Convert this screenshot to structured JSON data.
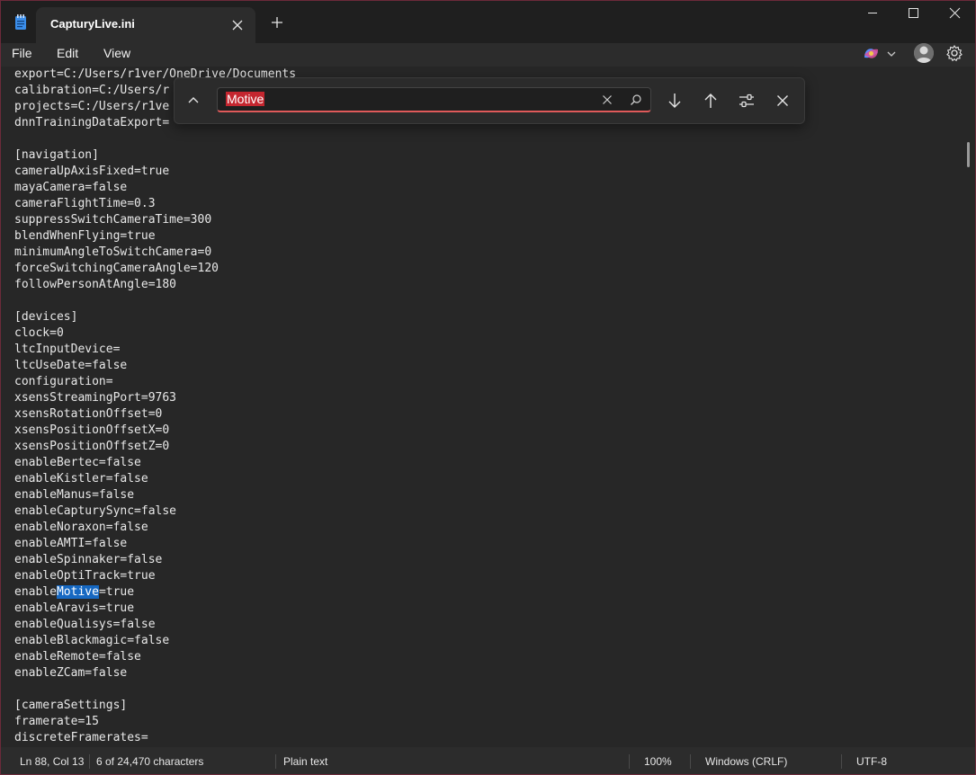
{
  "window": {
    "tab_title": "CapturyLive.ini"
  },
  "menu": {
    "file": "File",
    "edit": "Edit",
    "view": "View"
  },
  "find": {
    "query": "Motive"
  },
  "editor": {
    "lines": [
      "export=C:/Users/r1ver/OneDrive/Documents",
      "calibration=C:/Users/r",
      "projects=C:/Users/r1ve",
      "dnnTrainingDataExport=",
      "",
      "[navigation]",
      "cameraUpAxisFixed=true",
      "mayaCamera=false",
      "cameraFlightTime=0.3",
      "suppressSwitchCameraTime=300",
      "blendWhenFlying=true",
      "minimumAngleToSwitchCamera=0",
      "forceSwitchingCameraAngle=120",
      "followPersonAtAngle=180",
      "",
      "[devices]",
      "clock=0",
      "ltcInputDevice=",
      "ltcUseDate=false",
      "configuration=",
      "xsensStreamingPort=9763",
      "xsensRotationOffset=0",
      "xsensPositionOffsetX=0",
      "xsensPositionOffsetZ=0",
      "enableBertec=false",
      "enableKistler=false",
      "enableManus=false",
      "enableCapturySync=false",
      "enableNoraxon=false",
      "enableAMTI=false",
      "enableSpinnaker=false",
      "enableOptiTrack=true",
      "enableMotive=true",
      "enableAravis=true",
      "enableQualisys=false",
      "enableBlackmagic=false",
      "enableRemote=false",
      "enableZCam=false",
      "",
      "[cameraSettings]",
      "framerate=15",
      "discreteFramerates="
    ],
    "highlight_line_index": 32,
    "highlight_text": "Motive"
  },
  "status": {
    "position": "Ln 88, Col 13",
    "selection": "6 of 24,470 characters",
    "format": "Plain text",
    "zoom": "100%",
    "line_ending": "Windows (CRLF)",
    "encoding": "UTF-8"
  }
}
